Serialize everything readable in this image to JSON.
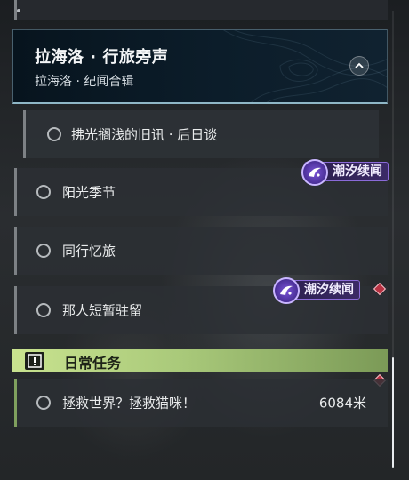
{
  "region": {
    "title": "拉海洛 · 行旅旁声",
    "subtitle": "拉海洛 · 纪闻合辑"
  },
  "quests": [
    {
      "label": "拂光搁浅的旧讯 · 后日谈"
    },
    {
      "label": "阳光季节"
    },
    {
      "label": "同行忆旅"
    },
    {
      "label": "那人短暂驻留"
    }
  ],
  "badge_label": "潮汐续闻",
  "daily": {
    "title": "日常任务",
    "quest_label": "拯救世界？拯救猫咪！",
    "distance": "6084米"
  },
  "icons": {
    "collapse": "chevron-up-icon",
    "quest_status": "ring-icon",
    "tide_badge": "tide-swirl-icon",
    "tracking": "red-diamond-marker-icon",
    "daily": "exclamation-icon"
  },
  "colors": {
    "region_header_bg": "#0c1d2a",
    "daily_header": "#b6d47f",
    "badge": "#3b2a66",
    "marker": "#b83242"
  }
}
